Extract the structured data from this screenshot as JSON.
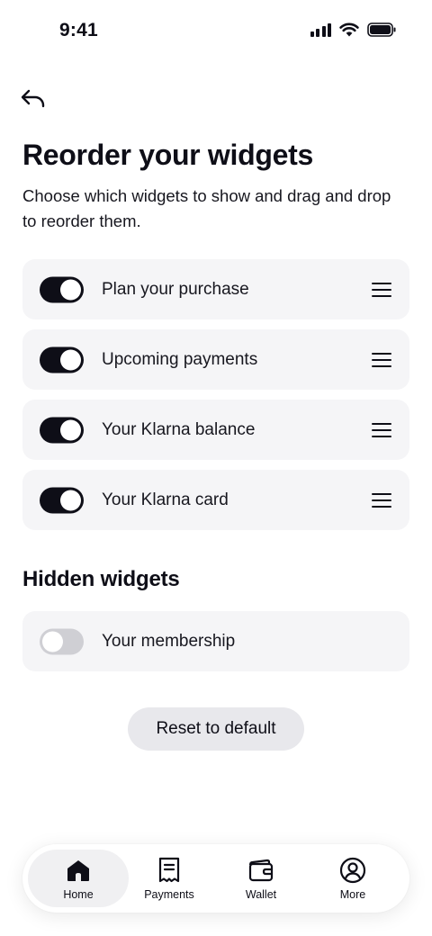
{
  "status_bar": {
    "time": "9:41"
  },
  "header": {
    "title": "Reorder your widgets",
    "subtitle": "Choose which widgets to show and drag and drop to reorder them."
  },
  "visible_widgets": [
    {
      "label": "Plan your purchase",
      "enabled": true
    },
    {
      "label": "Upcoming payments",
      "enabled": true
    },
    {
      "label": "Your Klarna balance",
      "enabled": true
    },
    {
      "label": "Your Klarna card",
      "enabled": true
    }
  ],
  "hidden_section": {
    "title": "Hidden widgets",
    "widgets": [
      {
        "label": "Your membership",
        "enabled": false
      }
    ]
  },
  "reset_label": "Reset to default",
  "bottom_nav": {
    "active": "Home",
    "items": [
      {
        "label": "Home",
        "icon": "home-icon"
      },
      {
        "label": "Payments",
        "icon": "receipt-icon"
      },
      {
        "label": "Wallet",
        "icon": "wallet-icon"
      },
      {
        "label": "More",
        "icon": "profile-icon"
      }
    ]
  },
  "colors": {
    "accent": "#0e0e17",
    "row_bg": "#f5f5f7",
    "toggle_off": "#cfcfd4"
  }
}
